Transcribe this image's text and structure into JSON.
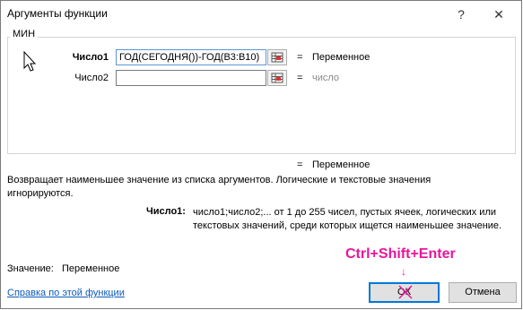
{
  "window": {
    "title": "Аргументы функции",
    "help": "?",
    "close": "✕"
  },
  "function_name": "МИН",
  "args": [
    {
      "label": "Число1",
      "value": "ГОД(СЕГОДНЯ())-ГОД(B3:B10)",
      "eq": "=",
      "result": "Переменное"
    },
    {
      "label": "Число2",
      "value": "",
      "eq": "=",
      "result": "число"
    }
  ],
  "overall": {
    "eq": "=",
    "result": "Переменное"
  },
  "description": "Возвращает наименьшее значение из списка аргументов. Логические и текстовые значения игнорируются.",
  "detail": {
    "label": "Число1:",
    "text": "число1;число2;... от 1 до 255 чисел, пустых ячеек, логических или текстовых значений, среди которых ищется наименьшее значение."
  },
  "value_row": {
    "label": "Значение:",
    "value": "Переменное"
  },
  "hint": "Ctrl+Shift+Enter",
  "help_link": "Справка по этой функции",
  "buttons": {
    "ok": "ОК",
    "cancel": "Отмена"
  },
  "colors": {
    "hint": "#e8169c",
    "link": "#0a5bbd",
    "focus": "#0078d7"
  }
}
